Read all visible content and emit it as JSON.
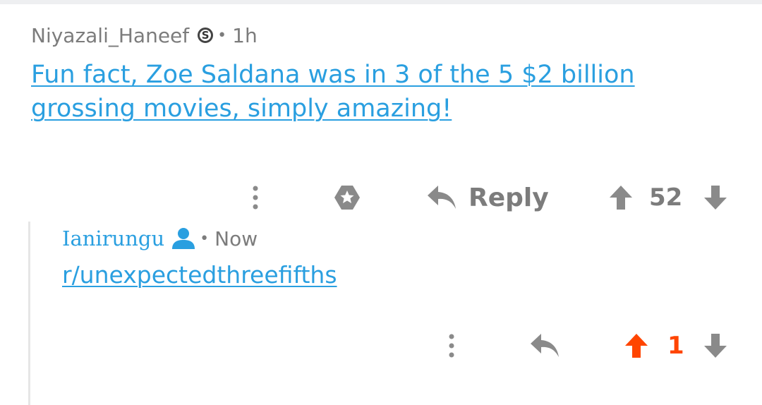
{
  "comment": {
    "username": "Niyazali_Haneef",
    "flair_icon": "s-badge-icon",
    "age": "1h",
    "body": "Fun fact, Zoe Saldana was in 3 of the 5 $2 billion grossing movies, simply amazing!",
    "actions": {
      "more_icon": "more-vertical-icon",
      "award_icon": "award-icon",
      "reply_icon": "reply-arrow-icon",
      "reply_label": "Reply",
      "upvote_icon": "upvote-arrow-icon",
      "score": "52",
      "downvote_icon": "downvote-arrow-icon"
    }
  },
  "reply": {
    "username": "Ianirungu",
    "user_icon": "user-icon",
    "age": "Now",
    "body": "r/unexpectedthreefifths",
    "actions": {
      "more_icon": "more-vertical-icon",
      "reply_icon": "reply-arrow-icon",
      "upvote_icon": "upvote-arrow-icon",
      "score": "1",
      "downvote_icon": "downvote-arrow-icon",
      "upvoted": true
    }
  },
  "colors": {
    "link": "#2a9fe0",
    "meta": "#7c7c7c",
    "upvote_active": "#ff4500",
    "icon_gray": "#8a8a8a"
  }
}
